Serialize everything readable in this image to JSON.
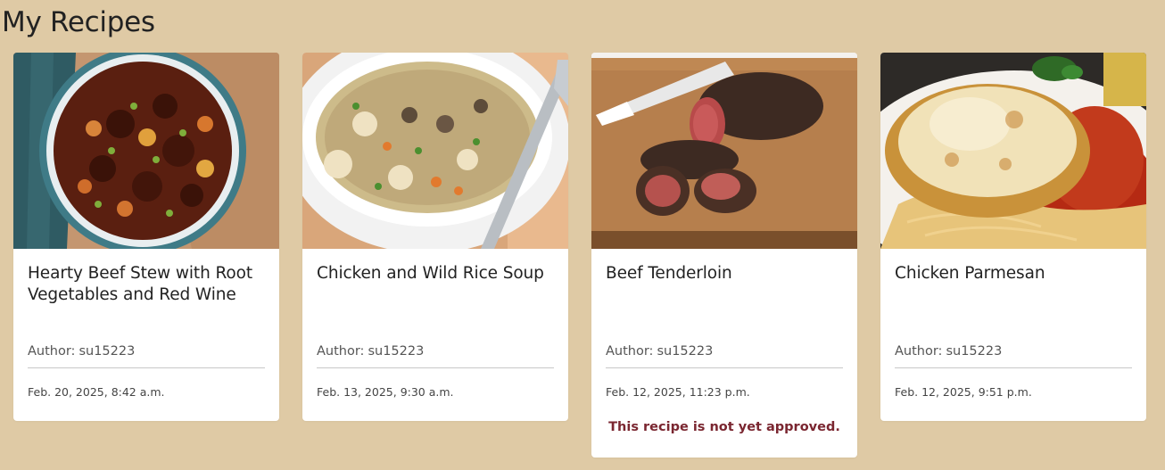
{
  "page": {
    "title": "My Recipes"
  },
  "labels": {
    "author_prefix": "Author:"
  },
  "recipes": [
    {
      "title": "Hearty Beef Stew with Root Vegetables and Red Wine",
      "author": "su15223",
      "date": "Feb. 20, 2025, 8:42 a.m.",
      "image_icon": "beef-stew-photo",
      "warning": ""
    },
    {
      "title": "Chicken and Wild Rice Soup",
      "author": "su15223",
      "date": "Feb. 13, 2025, 9:30 a.m.",
      "image_icon": "chicken-soup-photo",
      "warning": ""
    },
    {
      "title": "Beef Tenderloin",
      "author": "su15223",
      "date": "Feb. 12, 2025, 11:23 p.m.",
      "image_icon": "beef-tenderloin-photo",
      "warning": "This recipe is not yet approved."
    },
    {
      "title": "Chicken Parmesan",
      "author": "su15223",
      "date": "Feb. 12, 2025, 9:51 p.m.",
      "image_icon": "chicken-parmesan-photo",
      "warning": ""
    }
  ],
  "colors": {
    "page_background": "#dfcaa5",
    "card_background": "#ffffff",
    "warning_text": "#7a2630"
  }
}
